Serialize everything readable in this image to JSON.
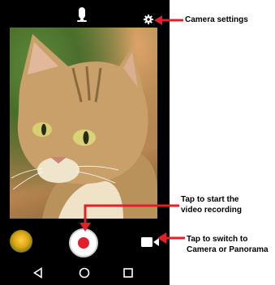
{
  "viewfinder": {
    "subject": "cat-photo"
  },
  "topbar": {
    "timer_icon": "timer-icon",
    "settings_icon": "gear-icon"
  },
  "controls": {
    "thumbnail_icon": "gallery-thumbnail",
    "shutter_icon": "record-button",
    "mode_icon": "video-camera-icon"
  },
  "navbar": {
    "back_icon": "back-triangle-icon",
    "home_icon": "home-circle-icon",
    "recent_icon": "recent-square-icon"
  },
  "callouts": {
    "settings": "Camera settings",
    "record": "Tap to start the\nvideo recording",
    "switch": "Tap to switch to\nCamera or Panorama"
  },
  "colors": {
    "record_red": "#e0202a",
    "callout_arrow": "#e0202a"
  }
}
